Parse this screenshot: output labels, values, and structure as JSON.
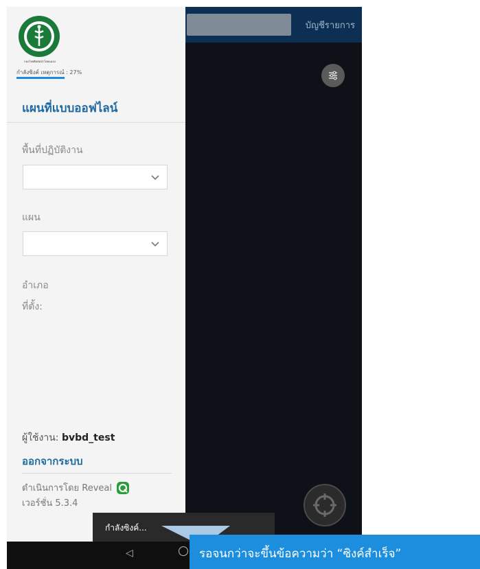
{
  "topbar": {
    "list_label": "บัญชีรายการ"
  },
  "drawer": {
    "logo_text": "กองโรคติดต่อนำโดยแมลง",
    "sync_status": "กำลังซิงค์ เหตุการณ์ : 27%",
    "sync_progress_percent": 27,
    "offline_maps_title": "แผนที่แบบออฟไลน์",
    "operational_area_label": "พื้นที่ปฏิบัติงาน",
    "plan_label": "แผน",
    "district_label": "อำเภอ",
    "location_label": "ที่ตั้ง:",
    "user_label": "ผู้ใช้งาน:",
    "username": "bvbd_test",
    "logout_label": "ออกจากระบบ",
    "powered_by": "ดำเนินการโดย Reveal",
    "version": "เวอร์ชั่น 5.3.4"
  },
  "toast": {
    "message": "กำลังซิงค์..."
  },
  "callout": {
    "text": "รอจนกว่าจะขึ้นข้อความว่า “ซิงค์สำเร็จ”"
  },
  "colors": {
    "accent": "#1e6aa0",
    "topbar": "#0c2f53",
    "callout": "#1d8ede",
    "progress": "#1e88e5"
  },
  "icons": [
    "moph-logo",
    "filter-icon",
    "chevron-down-icon",
    "reveal-logo-icon",
    "locate-icon",
    "back-nav-icon",
    "home-nav-icon"
  ]
}
